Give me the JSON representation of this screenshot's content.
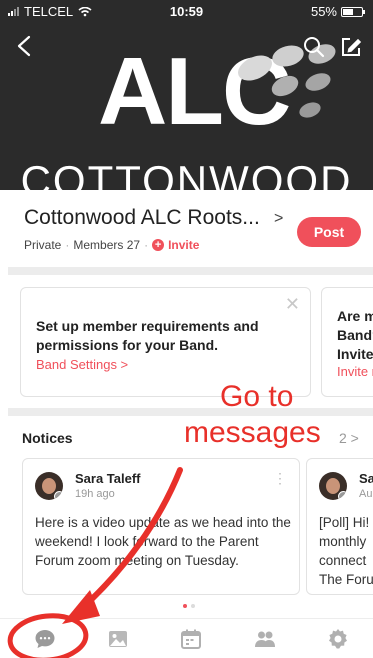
{
  "status": {
    "carrier": "TELCEL",
    "time": "10:59",
    "battery": "55%"
  },
  "cover": {
    "logo_letters": "ALC",
    "logo_word": "COTTONWOOD"
  },
  "band": {
    "name": "Cottonwood ALC Roots...",
    "privacy": "Private",
    "members": "Members 27",
    "invite": "Invite",
    "post_label": "Post"
  },
  "setup_cards": [
    {
      "title": "Set up member requirements and permissions for your Band.",
      "link": "Band Settings >"
    },
    {
      "title": "Are m Band? Invite",
      "link": "Invite r"
    }
  ],
  "notices": {
    "label": "Notices",
    "count": "2 >",
    "items": [
      {
        "author": "Sara Taleff",
        "time": "19h ago",
        "body": "Here is a video update as we head into the weekend! I look forward to the Parent Forum zoom meeting on Tuesday."
      },
      {
        "author": "Sa",
        "time": "Au",
        "body": "[Poll] Hi! monthly connect The Foru"
      }
    ]
  },
  "tabs": [
    {
      "icon": "chat-bubble-icon"
    },
    {
      "icon": "photo-icon"
    },
    {
      "icon": "calendar-icon"
    },
    {
      "icon": "members-icon"
    },
    {
      "icon": "gear-icon"
    }
  ],
  "annotation": {
    "line1": "Go to",
    "line2": "messages",
    "color": "#e8302a"
  },
  "colors": {
    "accent": "#f0505b",
    "cover_bg": "#2b2b2b"
  }
}
